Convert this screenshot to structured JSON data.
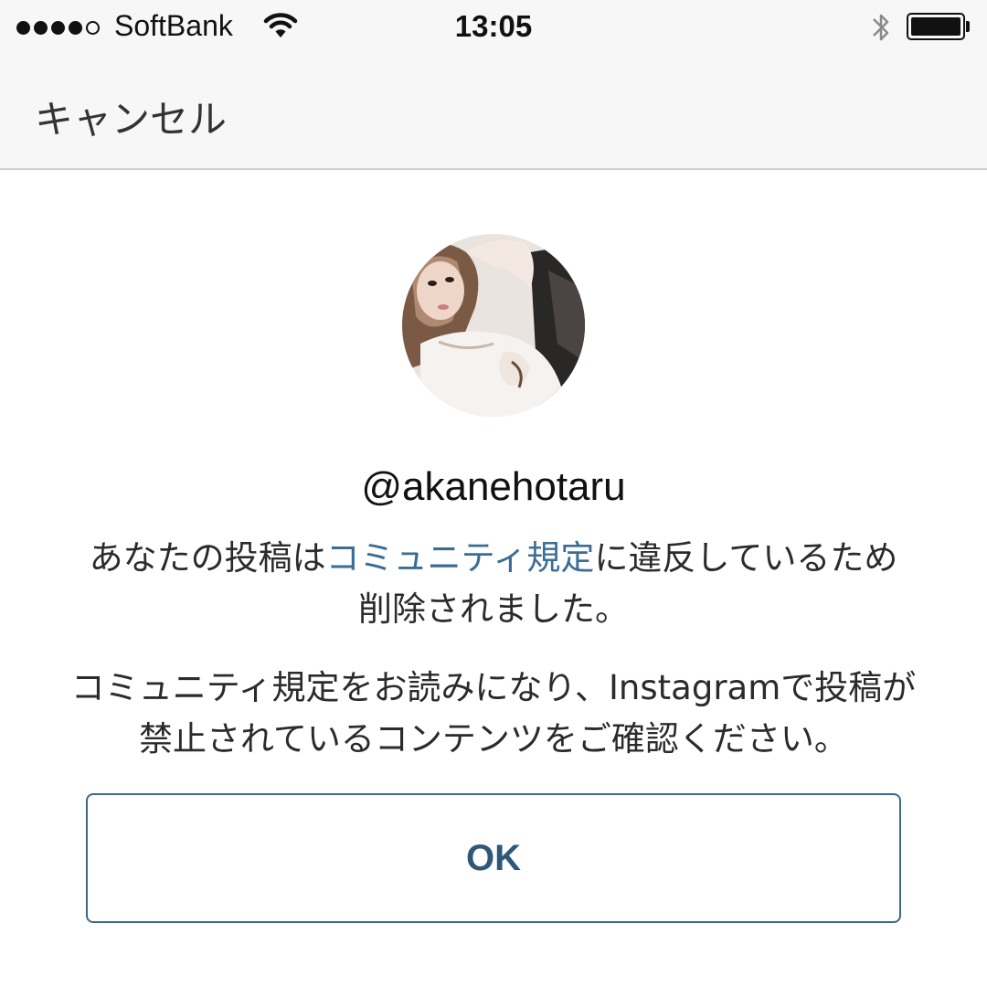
{
  "status_bar": {
    "carrier": "SoftBank",
    "time": "13:05",
    "signal_icon": "signal-dots-icon",
    "wifi_icon": "wifi-icon",
    "bluetooth_icon": "bluetooth-icon",
    "battery_icon": "battery-icon",
    "signal_strength": 4,
    "battery_level": 1.0
  },
  "nav": {
    "cancel_label": "キャンセル"
  },
  "profile": {
    "username": "@akanehotaru"
  },
  "message": {
    "line1_prefix": "あなたの投稿は",
    "line1_link": "コミュニティ規定",
    "line1_suffix": "に違反しているため",
    "line2": "削除されました。",
    "body_line1": "コミュニティ規定をお読みになり、Instagramで投稿が",
    "body_line2": "禁止されているコンテンツをご確認ください。"
  },
  "actions": {
    "ok_label": "OK"
  },
  "colors": {
    "link": "#3a6d96",
    "button_border": "#3f6786",
    "bar_background": "#f7f7f7"
  }
}
